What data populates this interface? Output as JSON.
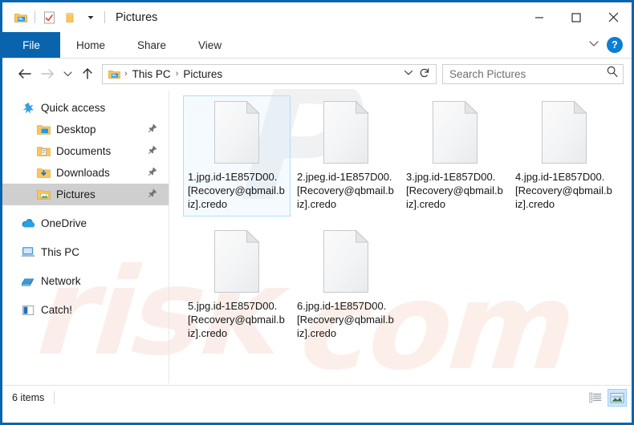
{
  "window": {
    "title": "Pictures",
    "quick_access_icons": [
      "explorer-icon",
      "properties-icon",
      "new-folder-icon",
      "dropdown-caret-icon"
    ],
    "controls": {
      "minimize": "—",
      "maximize": "□",
      "close": "✕"
    },
    "accent_color": "#0a64ad"
  },
  "ribbon": {
    "tabs": [
      {
        "label": "File",
        "active": true
      },
      {
        "label": "Home",
        "active": false
      },
      {
        "label": "Share",
        "active": false
      },
      {
        "label": "View",
        "active": false
      }
    ],
    "expand_caret": "∨",
    "help_label": "?"
  },
  "address": {
    "back_icon": "←",
    "forward_icon": "→",
    "recent_icon": "∨",
    "up_icon": "↑",
    "breadcrumbs": [
      "This PC",
      "Pictures"
    ],
    "separator": "›",
    "dropdown_icon": "∨",
    "refresh_icon": "↻"
  },
  "search": {
    "placeholder": "Search Pictures",
    "value": "",
    "icon": "search-icon"
  },
  "sidebar": {
    "items": [
      {
        "label": "Quick access",
        "icon": "star-icon",
        "level": 1,
        "selected": false,
        "pinned": false
      },
      {
        "label": "Desktop",
        "icon": "desktop-folder-icon",
        "level": 2,
        "selected": false,
        "pinned": true
      },
      {
        "label": "Documents",
        "icon": "documents-folder-icon",
        "level": 2,
        "selected": false,
        "pinned": true
      },
      {
        "label": "Downloads",
        "icon": "downloads-folder-icon",
        "level": 2,
        "selected": false,
        "pinned": true
      },
      {
        "label": "Pictures",
        "icon": "pictures-folder-icon",
        "level": 2,
        "selected": true,
        "pinned": true
      },
      {
        "label": "OneDrive",
        "icon": "onedrive-cloud-icon",
        "level": 1,
        "selected": false,
        "pinned": false
      },
      {
        "label": "This PC",
        "icon": "this-pc-icon",
        "level": 1,
        "selected": false,
        "pinned": false
      },
      {
        "label": "Network",
        "icon": "network-icon",
        "level": 1,
        "selected": false,
        "pinned": false
      },
      {
        "label": "Catch!",
        "icon": "catch-app-icon",
        "level": 1,
        "selected": false,
        "pinned": false
      }
    ]
  },
  "files": [
    {
      "name": "1.jpg.id-1E857D00.[Recovery@qbmail.biz].credo",
      "icon": "blank-file-icon",
      "selected": true
    },
    {
      "name": "2.jpeg.id-1E857D00.[Recovery@qbmail.biz].credo",
      "icon": "blank-file-icon",
      "selected": false
    },
    {
      "name": "3.jpg.id-1E857D00.[Recovery@qbmail.biz].credo",
      "icon": "blank-file-icon",
      "selected": false
    },
    {
      "name": "4.jpg.id-1E857D00.[Recovery@qbmail.biz].credo",
      "icon": "blank-file-icon",
      "selected": false
    },
    {
      "name": "5.jpg.id-1E857D00.[Recovery@qbmail.biz].credo",
      "icon": "blank-file-icon",
      "selected": false
    },
    {
      "name": "6.jpg.id-1E857D00.[Recovery@qbmail.biz].credo",
      "icon": "blank-file-icon",
      "selected": false
    }
  ],
  "status": {
    "item_count": "6 items",
    "views": [
      {
        "name": "details-view",
        "active": false
      },
      {
        "name": "large-icons-view",
        "active": true
      }
    ]
  },
  "watermark": {
    "top": "P",
    "mid": "risk",
    "right": "com"
  }
}
